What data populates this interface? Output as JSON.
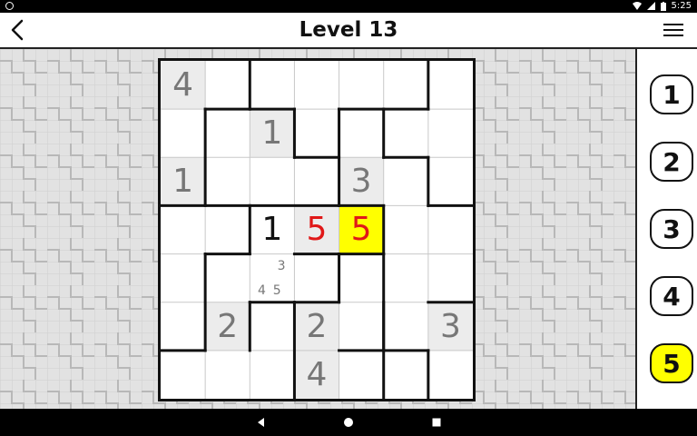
{
  "status_bar": {
    "time": "5:25"
  },
  "header": {
    "title": "Level 13"
  },
  "board": {
    "rows": 7,
    "cols": 7,
    "cells": [
      {
        "r": 0,
        "c": 0,
        "v": "4",
        "kind": "given"
      },
      {
        "r": 1,
        "c": 2,
        "v": "1",
        "kind": "given"
      },
      {
        "r": 2,
        "c": 0,
        "v": "1",
        "kind": "given"
      },
      {
        "r": 2,
        "c": 4,
        "v": "3",
        "kind": "given"
      },
      {
        "r": 3,
        "c": 2,
        "v": "1",
        "kind": "user"
      },
      {
        "r": 3,
        "c": 3,
        "v": "5",
        "kind": "error"
      },
      {
        "r": 3,
        "c": 4,
        "v": "5",
        "kind": "error-selected"
      },
      {
        "r": 5,
        "c": 1,
        "v": "2",
        "kind": "given"
      },
      {
        "r": 5,
        "c": 3,
        "v": "2",
        "kind": "given"
      },
      {
        "r": 5,
        "c": 6,
        "v": "3",
        "kind": "given"
      },
      {
        "r": 6,
        "c": 3,
        "v": "4",
        "kind": "given"
      }
    ],
    "notes": [
      {
        "r": 4,
        "c": 2,
        "values": [
          "3",
          "4",
          "5"
        ]
      }
    ]
  },
  "number_buttons": [
    {
      "label": "1",
      "active": false
    },
    {
      "label": "2",
      "active": false
    },
    {
      "label": "3",
      "active": false
    },
    {
      "label": "4",
      "active": false
    },
    {
      "label": "5",
      "active": true
    }
  ],
  "colors": {
    "selected": "#ffff00",
    "error": "#e01818",
    "given_bg": "#ececec"
  },
  "icons": {
    "back": "chevron-left-icon",
    "menu": "hamburger-menu-icon",
    "nav_back": "triangle-back-icon",
    "nav_home": "circle-home-icon",
    "nav_recent": "square-recents-icon"
  }
}
